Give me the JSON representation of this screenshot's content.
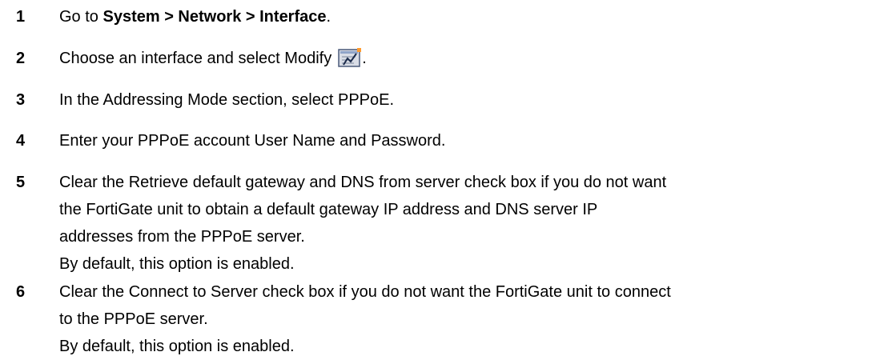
{
  "steps": [
    {
      "number": "1",
      "prefix": "Go to ",
      "path": "System > Network > Interface",
      "suffix": "."
    },
    {
      "number": "2",
      "text": "Choose an interface and select Modify",
      "icon": "modify-icon",
      "suffix": "."
    },
    {
      "number": "3",
      "text": "In the Addressing Mode section, select PPPoE."
    },
    {
      "number": "4",
      "text": "Enter your PPPoE account User Name and Password."
    },
    {
      "number": "5",
      "lines": [
        "Clear the Retrieve default gateway and DNS from server check box if you do not want",
        "the FortiGate unit to obtain a default gateway IP address and DNS server IP",
        "addresses from the PPPoE server."
      ],
      "note": "By default, this option is enabled."
    },
    {
      "number": "6",
      "lines": [
        "Clear the Connect to Server check box if you do not want the FortiGate unit to connect",
        "to the PPPoE server."
      ],
      "note": "By default, this option is enabled."
    }
  ]
}
